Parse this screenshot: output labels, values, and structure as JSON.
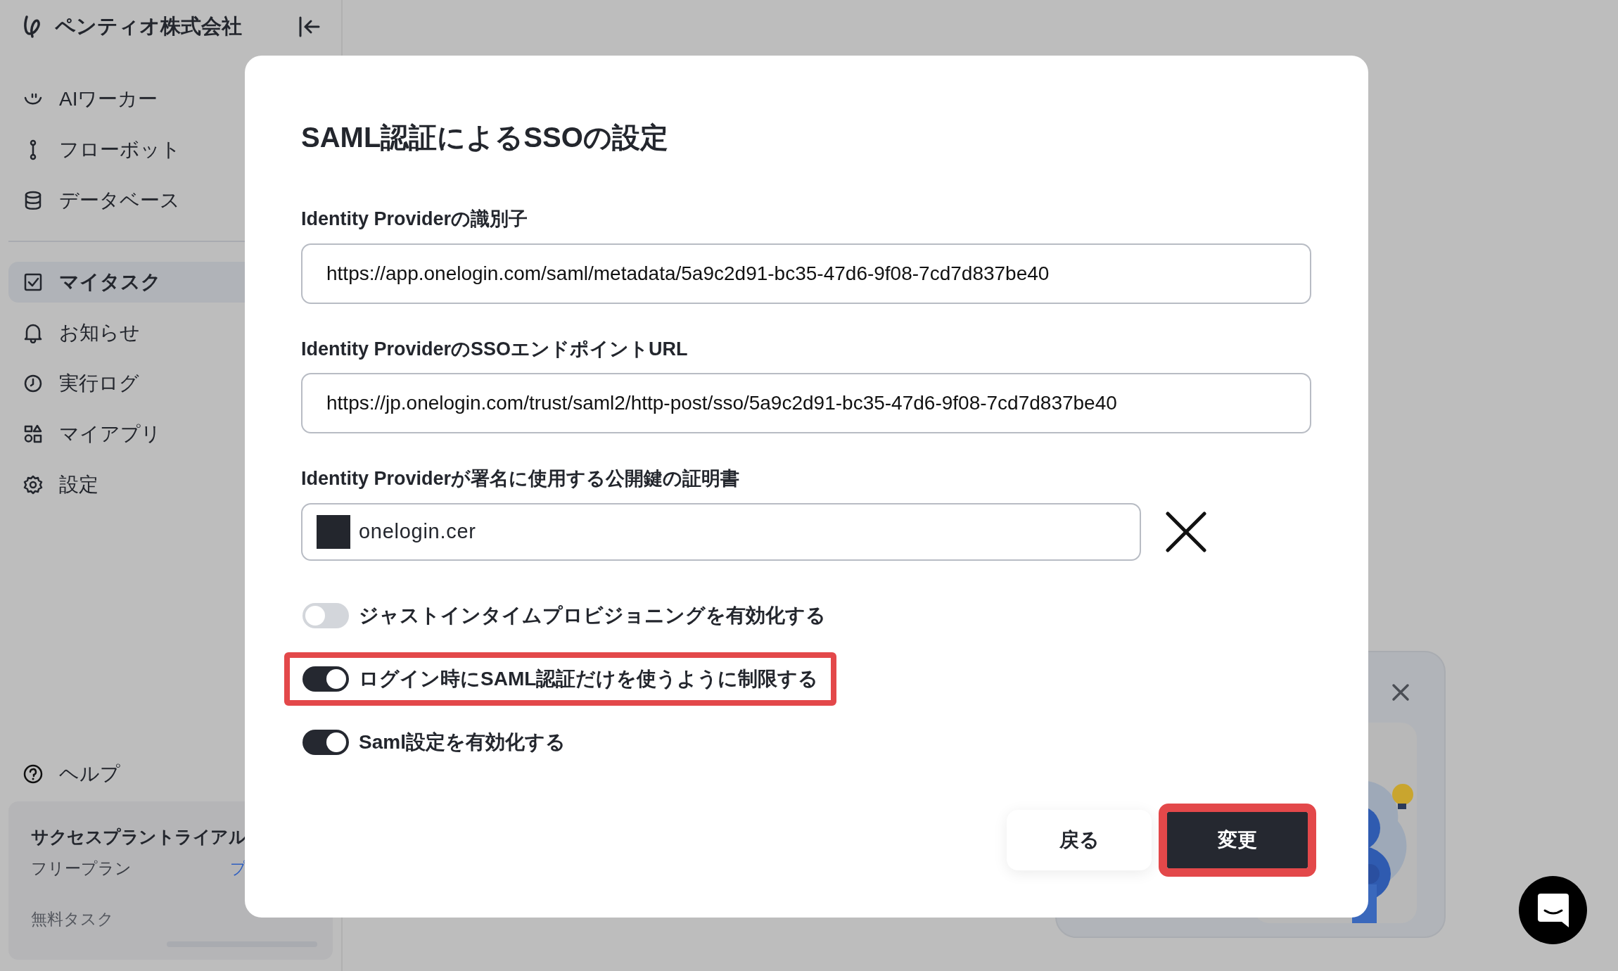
{
  "sidebar": {
    "company": "ペンティオ株式会社",
    "nav_top": [
      {
        "label": "AIワーカー",
        "selected": false
      },
      {
        "label": "フローボット",
        "selected": false
      },
      {
        "label": "データベース",
        "selected": false
      }
    ],
    "nav_main": [
      {
        "label": "マイタスク",
        "selected": true
      },
      {
        "label": "お知らせ",
        "selected": false
      },
      {
        "label": "実行ログ",
        "selected": false
      },
      {
        "label": "マイアプリ",
        "selected": false
      },
      {
        "label": "設定",
        "selected": false
      }
    ],
    "help": "ヘルプ",
    "plan_card": {
      "title": "サクセスプラントライアル",
      "plan": "フリープラン",
      "link": "プ",
      "tasks_label": "無料タスク"
    }
  },
  "modal": {
    "title": "SAML認証によるSSOの設定",
    "fields": [
      {
        "label": "Identity Providerの識別子",
        "value": "https://app.onelogin.com/saml/metadata/5a9c2d91-bc35-47d6-9f08-7cd7d837be40"
      },
      {
        "label": "Identity ProviderのSSOエンドポイントURL",
        "value": "https://jp.onelogin.com/trust/saml2/http-post/sso/5a9c2d91-bc35-47d6-9f08-7cd7d837be40"
      }
    ],
    "certificate": {
      "label": "Identity Providerが署名に使用する公開鍵の証明書",
      "file_name": "onelogin.cer"
    },
    "toggles": [
      {
        "label": "ジャストインタイムプロビジョニングを有効化する",
        "on": false,
        "highlighted": false
      },
      {
        "label": "ログイン時にSAML認証だけを使うように制限する",
        "on": true,
        "highlighted": true
      },
      {
        "label": "Saml設定を有効化する",
        "on": true,
        "highlighted": false
      }
    ],
    "buttons": [
      {
        "label": "戻る",
        "kind": "secondary",
        "highlighted": false
      },
      {
        "label": "変更",
        "kind": "primary",
        "highlighted": true
      }
    ]
  }
}
